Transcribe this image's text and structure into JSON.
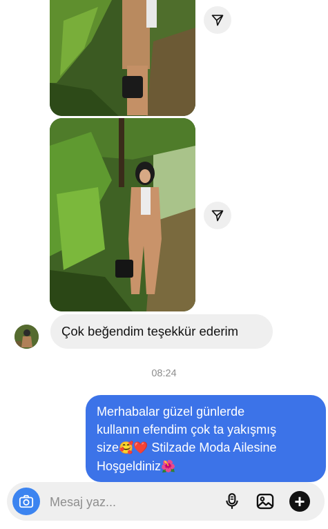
{
  "conversation": {
    "incoming_message": "Çok beğendim teşekkür ederim",
    "timestamp": "08:24",
    "outgoing_message": {
      "line1": "Merhabalar güzel günlerde",
      "line2": "kullanın efendim çok ta yakışmış",
      "line3_start": "size",
      "emoji1": "🥰",
      "emoji2": "❤️",
      "line3_end": " Stilzade Moda Ailesine",
      "line4": "Hoşgeldiniz",
      "emoji3": "🌺"
    }
  },
  "composer": {
    "placeholder": "Mesaj yaz..."
  },
  "icons": {
    "share": "paper-plane-icon",
    "camera": "camera-icon",
    "mic": "microphone-icon",
    "gallery": "image-icon",
    "plus": "plus-icon"
  },
  "colors": {
    "outgoing_bubble": "#3c73e8",
    "incoming_bubble": "#efefef",
    "camera_button": "#3c84f0",
    "timestamp": "#8e8e8e"
  }
}
